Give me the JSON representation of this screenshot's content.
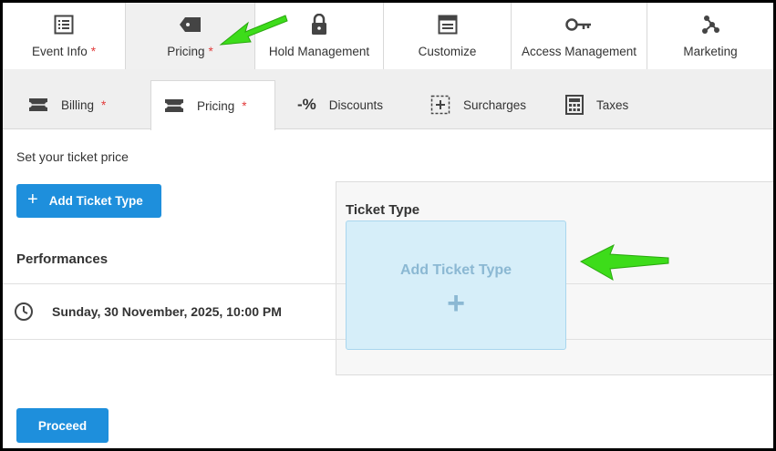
{
  "top_tabs": [
    {
      "label": "Event Info",
      "required": "*",
      "icon": "list-icon"
    },
    {
      "label": "Pricing",
      "required": "*",
      "icon": "price-tag-icon"
    },
    {
      "label": "Hold Management",
      "required": "",
      "icon": "lock-icon"
    },
    {
      "label": "Customize",
      "required": "",
      "icon": "browser-window-icon"
    },
    {
      "label": "Access Management",
      "required": "",
      "icon": "key-icon"
    },
    {
      "label": "Marketing",
      "required": "",
      "icon": "share-icon"
    }
  ],
  "sub_tabs": [
    {
      "label": "Billing",
      "required": "*",
      "icon": "ticket-icon"
    },
    {
      "label": "Pricing",
      "required": "*",
      "icon": "ticket-icon"
    },
    {
      "label": "Discounts",
      "required": "",
      "icon": "minus-percent-icon"
    },
    {
      "label": "Surcharges",
      "required": "",
      "icon": "dashed-plus-icon"
    },
    {
      "label": "Taxes",
      "required": "",
      "icon": "calculator-icon"
    }
  ],
  "main": {
    "instruction": "Set your ticket price",
    "add_ticket_button": "Add Ticket Type",
    "performances_heading": "Performances",
    "performance_date": "Sunday, 30 November, 2025, 10:00 PM",
    "ticket_type_heading": "Ticket Type",
    "add_ticket_card_text": "Add Ticket Type",
    "add_ticket_card_plus": "+",
    "proceed_button": "Proceed"
  },
  "colors": {
    "primary": "#1e8fdc",
    "required": "#e23b3b",
    "annotation_arrow": "#3ddc1a",
    "card_bg": "#d6eef9"
  }
}
